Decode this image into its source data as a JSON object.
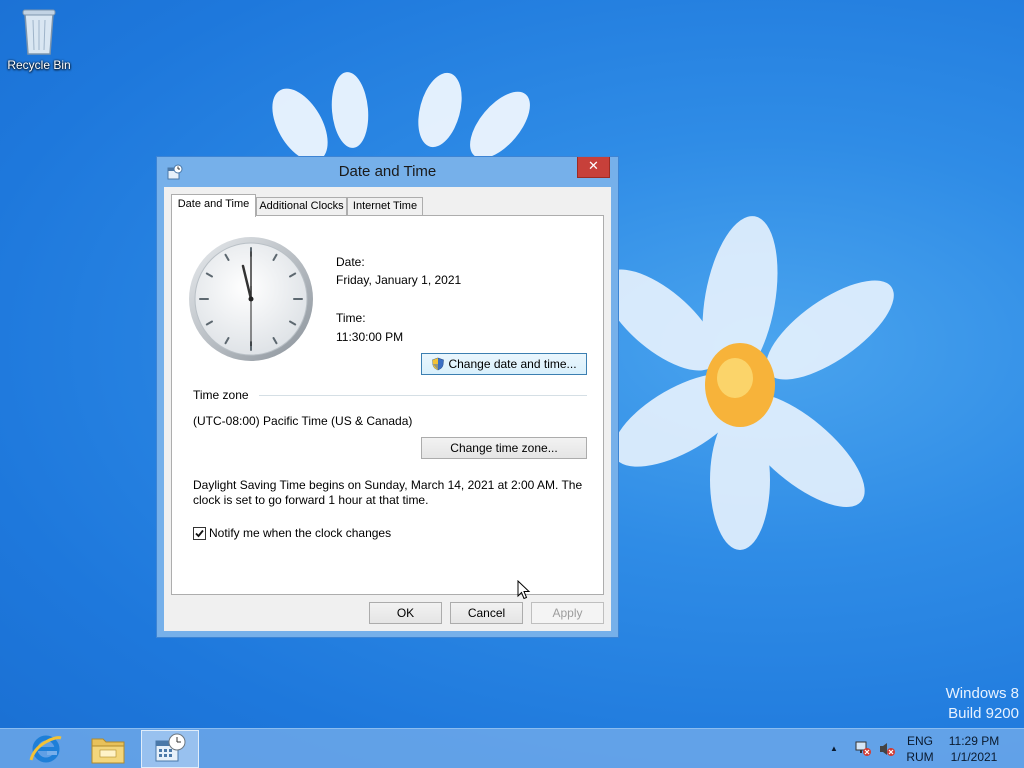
{
  "desktop": {
    "recycle_bin_label": "Recycle Bin",
    "watermark_line1": "Windows 8",
    "watermark_line2": "Build 9200"
  },
  "dialog": {
    "title": "Date and Time",
    "close_symbol": "✕",
    "tabs": [
      {
        "label": "Date and Time",
        "active": true
      },
      {
        "label": "Additional Clocks",
        "active": false
      },
      {
        "label": "Internet Time",
        "active": false
      }
    ],
    "date_label": "Date:",
    "date_value": "Friday, January 1, 2021",
    "time_label": "Time:",
    "time_value": "11:30:00 PM",
    "change_date_button": "Change date and time...",
    "timezone_header": "Time zone",
    "timezone_value": "(UTC-08:00) Pacific Time (US & Canada)",
    "change_timezone_button": "Change time zone...",
    "dst_line1": "Daylight Saving Time begins on Sunday, March 14, 2021 at 2:00 AM. The",
    "dst_line2": "clock is set to go forward 1 hour at that time.",
    "notify_label": "Notify me when the clock changes",
    "notify_checked": true,
    "ok_button": "OK",
    "cancel_button": "Cancel",
    "apply_button": "Apply"
  },
  "taskbar": {
    "language_line1": "ENG",
    "language_line2": "RUM",
    "clock_time": "11:29 PM",
    "clock_date": "1/1/2021",
    "show_hidden_symbol": "▲"
  },
  "colors": {
    "desktop_blue": "#2f8ce6",
    "window_frame": "#76b0ea",
    "close_red": "#c7403a",
    "panel_white": "#ffffff"
  }
}
